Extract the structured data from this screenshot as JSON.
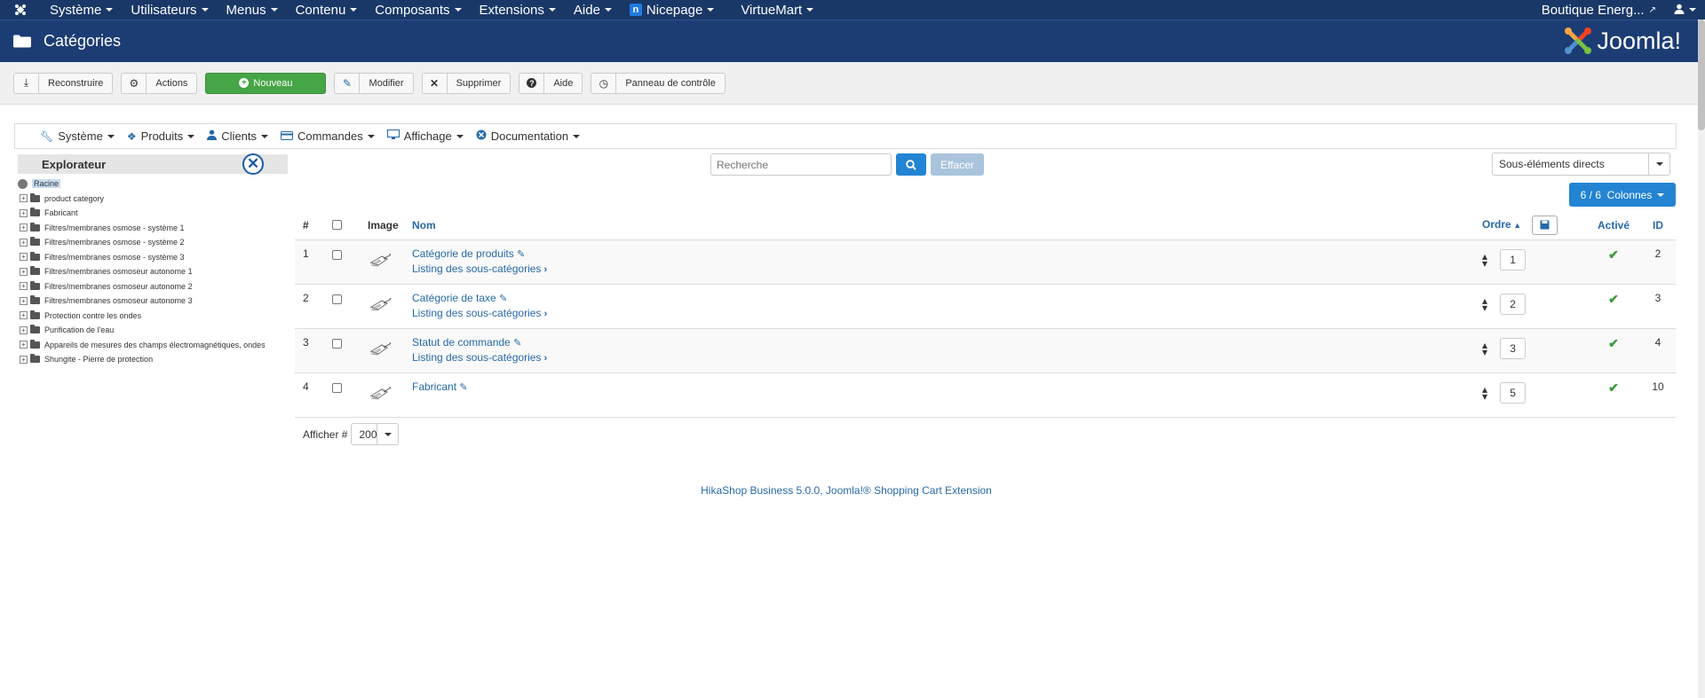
{
  "topbar": {
    "menus": [
      "Système",
      "Utilisateurs",
      "Menus",
      "Contenu",
      "Composants",
      "Extensions",
      "Aide"
    ],
    "nicepage": "Nicepage",
    "virtuemart": "VirtueMart",
    "site": "Boutique Energ...",
    "user_icon": "user-icon"
  },
  "header": {
    "title": "Catégories",
    "brand": "Joomla!"
  },
  "toolbar": {
    "rebuild": "Reconstruire",
    "actions": "Actions",
    "new": "Nouveau",
    "edit": "Modifier",
    "delete": "Supprimer",
    "help": "Aide",
    "panel": "Panneau de contrôle"
  },
  "vmenu": [
    "Système",
    "Produits",
    "Clients",
    "Commandes",
    "Affichage",
    "Documentation"
  ],
  "explorer": {
    "title": "Explorateur",
    "root": "Racine",
    "items": [
      "product category",
      "Fabricant",
      "Filtres/membranes osmose - système 1",
      "Filtres/membranes osmose - système 2",
      "Filtres/membranes osmose - système 3",
      "Filtres/membranes osmoseur autonome 1",
      "Filtres/membranes osmoseur autonome 2",
      "Filtres/membranes osmoseur autonome 3",
      "Protection contre les ondes",
      "Purification de l'eau",
      "Appareils de mesures des champs électromagnétiques, ondes",
      "Shungite - Pierre de protection"
    ]
  },
  "search": {
    "placeholder": "Recherche",
    "clear": "Effacer"
  },
  "filter": {
    "selected": "Sous-éléments directs"
  },
  "columns_btn": "6 / 6  Colonnes",
  "table": {
    "headers": {
      "num": "#",
      "image": "Image",
      "name": "Nom",
      "order": "Ordre",
      "active": "Activé",
      "id": "ID"
    },
    "sub_link": "Listing des sous-catégories",
    "rows": [
      {
        "num": "1",
        "name": "Catégorie de produits",
        "order": "1",
        "id": "2",
        "sub": true
      },
      {
        "num": "2",
        "name": "Catégorie de taxe",
        "order": "2",
        "id": "3",
        "sub": true
      },
      {
        "num": "3",
        "name": "Statut de commande",
        "order": "3",
        "id": "4",
        "sub": true
      },
      {
        "num": "4",
        "name": "Fabricant",
        "order": "5",
        "id": "10",
        "sub": false
      }
    ]
  },
  "pager": {
    "label": "Afficher #",
    "value": "200"
  },
  "footer": "HikaShop Business 5.0.0, Joomla!® Shopping Cart Extension"
}
